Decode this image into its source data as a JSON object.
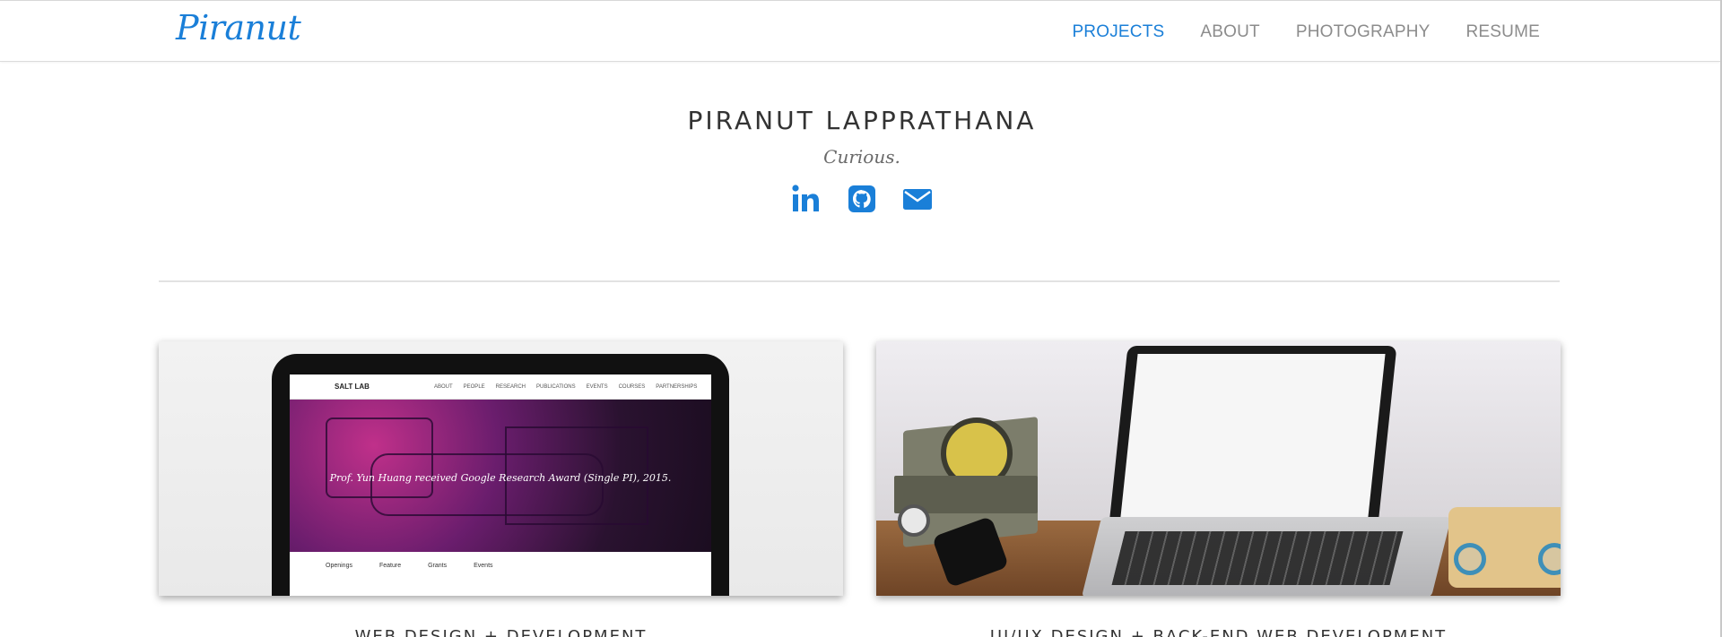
{
  "navbar": {
    "brand": "Piranut",
    "links": [
      {
        "label": "PROJECTS",
        "active": true
      },
      {
        "label": "ABOUT",
        "active": false
      },
      {
        "label": "PHOTOGRAPHY",
        "active": false
      },
      {
        "label": "RESUME",
        "active": false
      }
    ]
  },
  "hero": {
    "name": "PIRANUT LAPPRATHANA",
    "tagline": "Curious.",
    "social_icons": [
      "linkedin-icon",
      "github-icon",
      "email-icon"
    ]
  },
  "colors": {
    "accent": "#1a7fd8",
    "nav_inactive": "#8c8c8c",
    "text": "#333333"
  },
  "projects": [
    {
      "title": "WEB DESIGN + DEVELOPMENT",
      "preview": {
        "site_name": "SALT LAB",
        "nav": [
          "ABOUT",
          "PEOPLE",
          "RESEARCH",
          "PUBLICATIONS",
          "EVENTS",
          "COURSES",
          "PARTNERSHIPS"
        ],
        "caption": "Prof. Yun Huang received Google Research Award (Single PI), 2015.",
        "columns": [
          "Openings",
          "Feature",
          "Grants",
          "Events"
        ]
      }
    },
    {
      "title": "UI/UX DESIGN + BACK-END WEB DEVELOPMENT"
    }
  ]
}
